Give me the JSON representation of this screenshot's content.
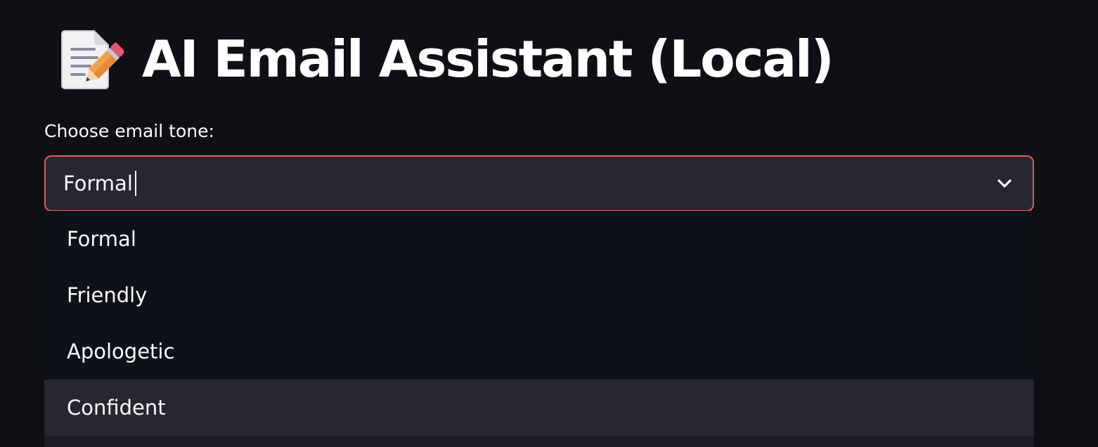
{
  "header": {
    "title": "AI Email Assistant (Local)",
    "icon": "memo-pencil-icon"
  },
  "tone_select": {
    "label": "Choose email tone:",
    "value": "Formal",
    "options": [
      "Formal",
      "Friendly",
      "Apologetic",
      "Confident"
    ],
    "highlighted_option": "Confident"
  },
  "colors": {
    "background": "#0f1016",
    "input_background": "#262730",
    "focus_border": "#e45d52",
    "text": "#fafafa"
  }
}
